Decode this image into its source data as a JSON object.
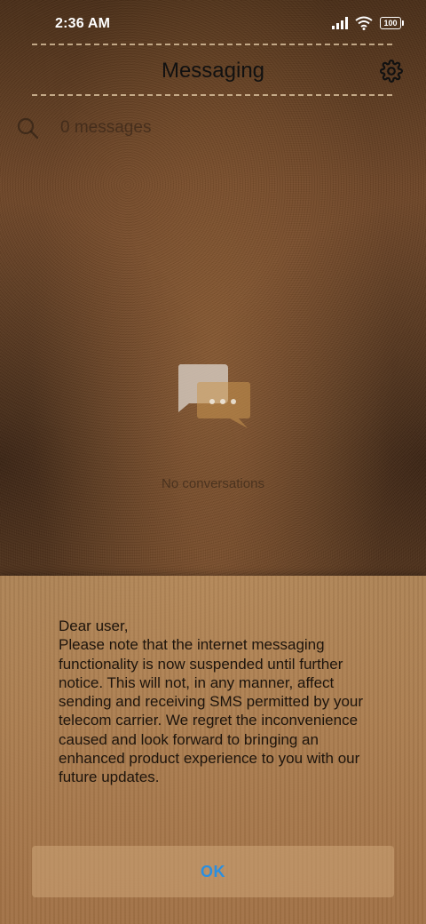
{
  "status_bar": {
    "time": "2:36 AM",
    "battery": "100"
  },
  "header": {
    "title": "Messaging"
  },
  "search": {
    "placeholder": "0 messages"
  },
  "empty_state": {
    "label": "No conversations"
  },
  "dialog": {
    "message": "Dear user,\nPlease note that the internet messaging functionality is now suspended until further notice. This will not, in any manner, affect sending and receiving SMS permitted by your telecom carrier. We regret the inconvenience caused and look forward to bringing an enhanced product experience to you with our future updates.",
    "ok_label": "OK"
  },
  "colors": {
    "accent": "#2a8fe0",
    "title_text": "#111111",
    "status_text": "#ffffff"
  },
  "icons": [
    "signal-icon",
    "wifi-icon",
    "battery-icon",
    "gear-icon",
    "search-icon",
    "chat-bubble-icon"
  ]
}
